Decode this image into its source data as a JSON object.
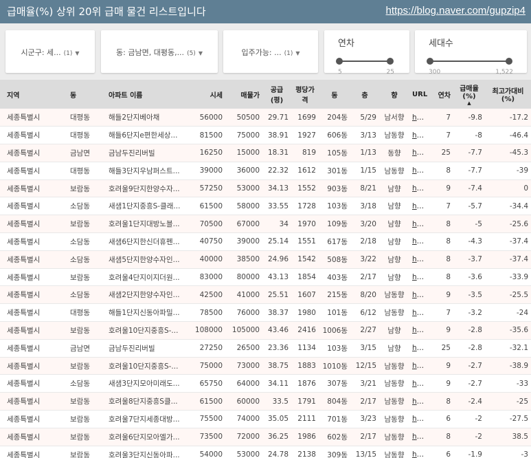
{
  "header": {
    "title": "급매율(%) 상위 20위 급매 물건 리스트입니다",
    "link": "https://blog.naver.com/gupzip4"
  },
  "filters": {
    "city": {
      "label": "시군구: 세...",
      "count": "(1)"
    },
    "dong": {
      "label": "동: 금남면, 대평동,...",
      "count": "(5)"
    },
    "movein": {
      "label": "입주가능: ...",
      "count": "(1)"
    },
    "year": {
      "label": "연차",
      "min": "5",
      "max": "25"
    },
    "households": {
      "label": "세대수",
      "min": "300",
      "max": "1,522"
    }
  },
  "table": {
    "headers": [
      "지역",
      "동",
      "아파트 이름",
      "시세",
      "매물가",
      "공급(평)",
      "평당가격",
      "동",
      "층",
      "향",
      "URL",
      "연차",
      "급매율(%)",
      "최고가대비(%)"
    ],
    "rows": [
      [
        "세종특별시",
        "대평동",
        "해들2단지베아채",
        "56000",
        "50500",
        "29.71",
        "1699",
        "204동",
        "5/29",
        "남서향",
        "htt...",
        "7",
        "-9.8",
        "-17.2"
      ],
      [
        "세종특별시",
        "대평동",
        "해들6단지e편한세상...",
        "81500",
        "75000",
        "38.91",
        "1927",
        "606동",
        "3/13",
        "남동향",
        "htt...",
        "7",
        "-8",
        "-46.4"
      ],
      [
        "세종특별시",
        "금남면",
        "금남두진리버빌",
        "16250",
        "15000",
        "18.31",
        "819",
        "105동",
        "1/13",
        "동향",
        "htt...",
        "25",
        "-7.7",
        "-45.3"
      ],
      [
        "세종특별시",
        "대평동",
        "해들3단지우남퍼스트...",
        "39000",
        "36000",
        "22.32",
        "1612",
        "301동",
        "1/15",
        "남동향",
        "htt...",
        "8",
        "-7.7",
        "-39"
      ],
      [
        "세종특별시",
        "보람동",
        "호려울9단지한양수자...",
        "57250",
        "53000",
        "34.13",
        "1552",
        "903동",
        "8/21",
        "남향",
        "htt...",
        "9",
        "-7.4",
        "0"
      ],
      [
        "세종특별시",
        "소담동",
        "새샘1단지중흥S-클래...",
        "61500",
        "58000",
        "33.55",
        "1728",
        "103동",
        "3/18",
        "남향",
        "htt...",
        "7",
        "-5.7",
        "-34.4"
      ],
      [
        "세종특별시",
        "보람동",
        "호려울1단지대방노블...",
        "70500",
        "67000",
        "34",
        "1970",
        "109동",
        "3/20",
        "남향",
        "htt...",
        "8",
        "-5",
        "-25.6"
      ],
      [
        "세종특별시",
        "소담동",
        "새샘6단지한신더휴펜...",
        "40750",
        "39000",
        "25.14",
        "1551",
        "617동",
        "2/18",
        "남향",
        "htt...",
        "8",
        "-4.3",
        "-37.4"
      ],
      [
        "세종특별시",
        "소담동",
        "새샘5단지한양수자인...",
        "40000",
        "38500",
        "24.96",
        "1542",
        "508동",
        "3/22",
        "남향",
        "htt...",
        "8",
        "-3.7",
        "-37.4"
      ],
      [
        "세종특별시",
        "보람동",
        "호려울4단지이지더원...",
        "83000",
        "80000",
        "43.13",
        "1854",
        "403동",
        "2/17",
        "남향",
        "htt...",
        "8",
        "-3.6",
        "-33.9"
      ],
      [
        "세종특별시",
        "소담동",
        "새샘2단지한양수자인...",
        "42500",
        "41000",
        "25.51",
        "1607",
        "215동",
        "8/20",
        "남동향",
        "htt...",
        "9",
        "-3.5",
        "-25.5"
      ],
      [
        "세종특별시",
        "대평동",
        "해들1단지신동아파밀...",
        "78500",
        "76000",
        "38.37",
        "1980",
        "101동",
        "6/12",
        "남동향",
        "htt...",
        "7",
        "-3.2",
        "-24"
      ],
      [
        "세종특별시",
        "보람동",
        "호려울10단지중흥S-...",
        "108000",
        "105000",
        "43.46",
        "2416",
        "1006동",
        "2/27",
        "남향",
        "htt...",
        "9",
        "-2.8",
        "-35.6"
      ],
      [
        "세종특별시",
        "금남면",
        "금남두진리버빌",
        "27250",
        "26500",
        "23.36",
        "1134",
        "103동",
        "3/15",
        "남향",
        "htt...",
        "25",
        "-2.8",
        "-32.1"
      ],
      [
        "세종특별시",
        "보람동",
        "호려울10단지중흥S-...",
        "75000",
        "73000",
        "38.75",
        "1883",
        "1010동",
        "12/15",
        "남동향",
        "htt...",
        "9",
        "-2.7",
        "-38.9"
      ],
      [
        "세종특별시",
        "소담동",
        "새샘3단지모아미래도...",
        "65750",
        "64000",
        "34.11",
        "1876",
        "307동",
        "3/21",
        "남동향",
        "htt...",
        "9",
        "-2.7",
        "-33"
      ],
      [
        "세종특별시",
        "보람동",
        "호려울8단지중흥S클...",
        "61500",
        "60000",
        "33.5",
        "1791",
        "804동",
        "2/17",
        "남동향",
        "htt...",
        "8",
        "-2.4",
        "-25"
      ],
      [
        "세종특별시",
        "보람동",
        "호려울7단지세종대방...",
        "75500",
        "74000",
        "35.05",
        "2111",
        "701동",
        "3/23",
        "남동향",
        "htt...",
        "6",
        "-2",
        "-27.5"
      ],
      [
        "세종특별시",
        "보람동",
        "호려울6단지모아엘가...",
        "73500",
        "72000",
        "36.25",
        "1986",
        "602동",
        "2/17",
        "남동향",
        "htt...",
        "8",
        "-2",
        "38.5"
      ],
      [
        "세종특별시",
        "보람동",
        "호려울3단지신동아파...",
        "54000",
        "53000",
        "24.78",
        "2138",
        "309동",
        "13/15",
        "남동향",
        "htt...",
        "6",
        "-1.9",
        "-3"
      ]
    ]
  }
}
